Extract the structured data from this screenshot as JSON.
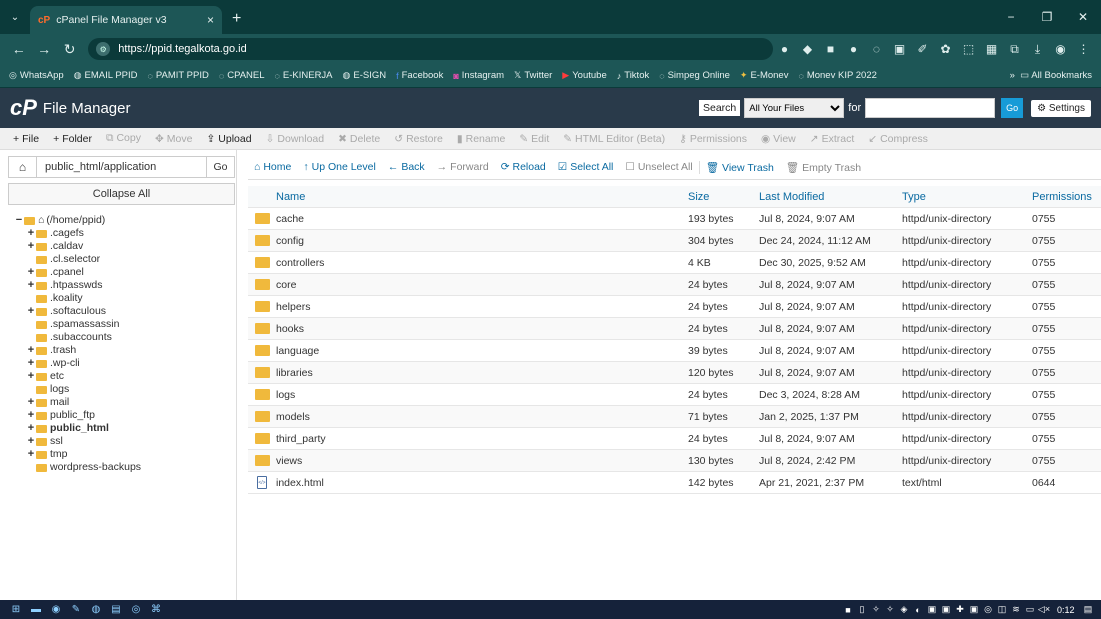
{
  "browser": {
    "tab_title": "cPanel File Manager v3",
    "url": "https://ppid.tegalkota.go.id",
    "all_bookmarks": "All Bookmarks",
    "bookmarks": [
      "WhatsApp",
      "EMAIL PPID",
      "PAMIT PPID",
      "CPANEL",
      "E-KINERJA",
      "E-SIGN",
      "Facebook",
      "Instagram",
      "Twitter",
      "Youtube",
      "Tiktok",
      "Simpeg Online",
      "E-Monev",
      "Monev KIP 2022"
    ]
  },
  "header": {
    "logo": "cP",
    "title": "File Manager",
    "search_label": "Search",
    "search_scope": "All Your Files",
    "for_label": "for",
    "go_label": "Go",
    "settings_label": "Settings"
  },
  "toolbar": [
    {
      "label": "File",
      "icon": "+",
      "enabled": true
    },
    {
      "label": "Folder",
      "icon": "+",
      "enabled": true
    },
    {
      "label": "Copy",
      "icon": "⧉",
      "enabled": false
    },
    {
      "label": "Move",
      "icon": "✥",
      "enabled": false
    },
    {
      "label": "Upload",
      "icon": "⇪",
      "enabled": true
    },
    {
      "label": "Download",
      "icon": "⇩",
      "enabled": false
    },
    {
      "label": "Delete",
      "icon": "✖",
      "enabled": false
    },
    {
      "label": "Restore",
      "icon": "↺",
      "enabled": false
    },
    {
      "label": "Rename",
      "icon": "▮",
      "enabled": false
    },
    {
      "label": "Edit",
      "icon": "✎",
      "enabled": false
    },
    {
      "label": "HTML Editor (Beta)",
      "icon": "✎",
      "enabled": false
    },
    {
      "label": "Permissions",
      "icon": "⚷",
      "enabled": false
    },
    {
      "label": "View",
      "icon": "◉",
      "enabled": false
    },
    {
      "label": "Extract",
      "icon": "↗",
      "enabled": false
    },
    {
      "label": "Compress",
      "icon": "↙",
      "enabled": false
    }
  ],
  "sidebar": {
    "path_value": "public_html/application",
    "go_label": "Go",
    "collapse_label": "Collapse All",
    "tree": [
      {
        "label": "(/home/ppid)",
        "toggle": "−",
        "level": 0,
        "root": true
      },
      {
        "label": ".cagefs",
        "toggle": "+",
        "level": 1
      },
      {
        "label": ".caldav",
        "toggle": "+",
        "level": 1
      },
      {
        "label": ".cl.selector",
        "toggle": "",
        "level": 1
      },
      {
        "label": ".cpanel",
        "toggle": "+",
        "level": 1
      },
      {
        "label": ".htpasswds",
        "toggle": "+",
        "level": 1
      },
      {
        "label": ".koality",
        "toggle": "",
        "level": 1
      },
      {
        "label": ".softaculous",
        "toggle": "+",
        "level": 1
      },
      {
        "label": ".spamassassin",
        "toggle": "",
        "level": 1
      },
      {
        "label": ".subaccounts",
        "toggle": "",
        "level": 1
      },
      {
        "label": ".trash",
        "toggle": "+",
        "level": 1
      },
      {
        "label": ".wp-cli",
        "toggle": "+",
        "level": 1
      },
      {
        "label": "etc",
        "toggle": "+",
        "level": 1
      },
      {
        "label": "logs",
        "toggle": "",
        "level": 1
      },
      {
        "label": "mail",
        "toggle": "+",
        "level": 1
      },
      {
        "label": "public_ftp",
        "toggle": "+",
        "level": 1
      },
      {
        "label": "public_html",
        "toggle": "+",
        "level": 1,
        "bold": true
      },
      {
        "label": "ssl",
        "toggle": "+",
        "level": 1
      },
      {
        "label": "tmp",
        "toggle": "+",
        "level": 1
      },
      {
        "label": "wordpress-backups",
        "toggle": "",
        "level": 1
      }
    ]
  },
  "actions": [
    {
      "label": "Home",
      "icon": "⌂"
    },
    {
      "label": "Up One Level",
      "icon": "↑"
    },
    {
      "label": "Back",
      "icon": "←"
    },
    {
      "label": "Forward",
      "icon": "→",
      "gray": true
    },
    {
      "label": "Reload",
      "icon": "⟳"
    },
    {
      "label": "Select All",
      "icon": "☑"
    },
    {
      "label": "Unselect All",
      "icon": "☐",
      "gray": true
    },
    {
      "label": "View Trash",
      "icon": "🗑"
    },
    {
      "label": "Empty Trash",
      "icon": "🗑",
      "gray": true
    }
  ],
  "table": {
    "headers": [
      "Name",
      "Size",
      "Last Modified",
      "Type",
      "Permissions"
    ],
    "rows": [
      {
        "name": "cache",
        "size": "193 bytes",
        "modified": "Jul 8, 2024, 9:07 AM",
        "type": "httpd/unix-directory",
        "perm": "0755",
        "kind": "folder"
      },
      {
        "name": "config",
        "size": "304 bytes",
        "modified": "Dec 24, 2024, 11:12 AM",
        "type": "httpd/unix-directory",
        "perm": "0755",
        "kind": "folder"
      },
      {
        "name": "controllers",
        "size": "4 KB",
        "modified": "Dec 30, 2025, 9:52 AM",
        "type": "httpd/unix-directory",
        "perm": "0755",
        "kind": "folder"
      },
      {
        "name": "core",
        "size": "24 bytes",
        "modified": "Jul 8, 2024, 9:07 AM",
        "type": "httpd/unix-directory",
        "perm": "0755",
        "kind": "folder"
      },
      {
        "name": "helpers",
        "size": "24 bytes",
        "modified": "Jul 8, 2024, 9:07 AM",
        "type": "httpd/unix-directory",
        "perm": "0755",
        "kind": "folder"
      },
      {
        "name": "hooks",
        "size": "24 bytes",
        "modified": "Jul 8, 2024, 9:07 AM",
        "type": "httpd/unix-directory",
        "perm": "0755",
        "kind": "folder"
      },
      {
        "name": "language",
        "size": "39 bytes",
        "modified": "Jul 8, 2024, 9:07 AM",
        "type": "httpd/unix-directory",
        "perm": "0755",
        "kind": "folder"
      },
      {
        "name": "libraries",
        "size": "120 bytes",
        "modified": "Jul 8, 2024, 9:07 AM",
        "type": "httpd/unix-directory",
        "perm": "0755",
        "kind": "folder"
      },
      {
        "name": "logs",
        "size": "24 bytes",
        "modified": "Dec 3, 2024, 8:28 AM",
        "type": "httpd/unix-directory",
        "perm": "0755",
        "kind": "folder"
      },
      {
        "name": "models",
        "size": "71 bytes",
        "modified": "Jan 2, 2025, 1:37 PM",
        "type": "httpd/unix-directory",
        "perm": "0755",
        "kind": "folder"
      },
      {
        "name": "third_party",
        "size": "24 bytes",
        "modified": "Jul 8, 2024, 9:07 AM",
        "type": "httpd/unix-directory",
        "perm": "0755",
        "kind": "folder"
      },
      {
        "name": "views",
        "size": "130 bytes",
        "modified": "Jul 8, 2024, 2:42 PM",
        "type": "httpd/unix-directory",
        "perm": "0755",
        "kind": "folder"
      },
      {
        "name": "index.html",
        "size": "142 bytes",
        "modified": "Apr 21, 2021, 2:37 PM",
        "type": "text/html",
        "perm": "0644",
        "kind": "file"
      }
    ]
  },
  "taskbar": {
    "clock": "0:12"
  },
  "colors": {
    "chrome_dark": "#0b3a3a",
    "chrome": "#1d5656",
    "cpanel_header": "#293a4a",
    "link": "#0a6aa1",
    "folder": "#f0b93c"
  }
}
